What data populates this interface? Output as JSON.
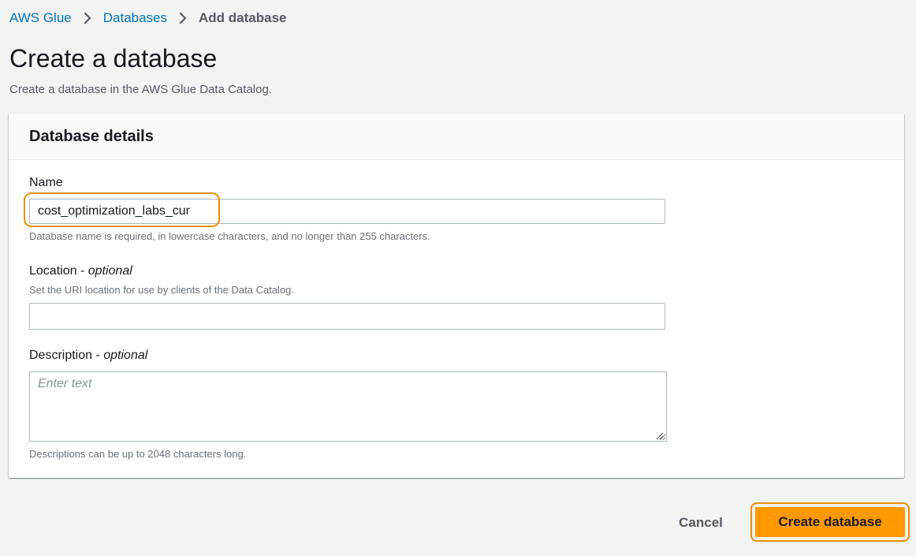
{
  "breadcrumb": {
    "items": [
      {
        "label": "AWS Glue"
      },
      {
        "label": "Databases"
      },
      {
        "label": "Add database"
      }
    ]
  },
  "page": {
    "title": "Create a database",
    "subtitle": "Create a database in the AWS Glue Data Catalog."
  },
  "panel": {
    "title": "Database details"
  },
  "form": {
    "name": {
      "label": "Name",
      "value": "cost_optimization_labs_cur",
      "hint": "Database name is required, in lowercase characters, and no longer than 255 characters."
    },
    "location": {
      "label": "Location",
      "optional": "optional",
      "hint": "Set the URI location for use by clients of the Data Catalog.",
      "value": ""
    },
    "description": {
      "label": "Description",
      "optional": "optional",
      "placeholder": "Enter text",
      "hint": "Descriptions can be up to 2048 characters long."
    }
  },
  "actions": {
    "cancel_label": "Cancel",
    "create_label": "Create database"
  },
  "colors": {
    "link": "#0073bb",
    "primary_button": "#ff9900",
    "highlight_outline": "#ec8f00",
    "page_background": "#f2f3f3"
  }
}
